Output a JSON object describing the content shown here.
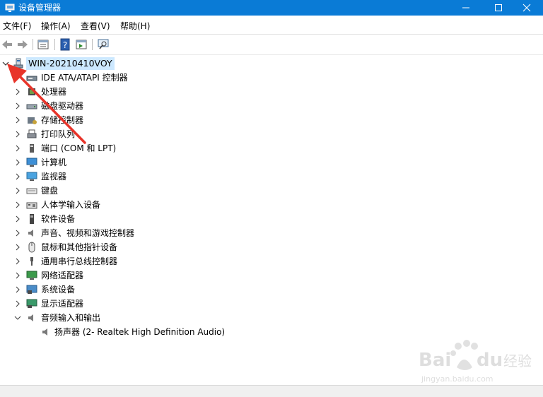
{
  "window": {
    "title": "设备管理器",
    "title_bar_color": "#0a7bd6"
  },
  "menu": {
    "items": [
      "文件(F)",
      "操作(A)",
      "查看(V)",
      "帮助(H)"
    ]
  },
  "toolbar": {
    "icons": [
      "back-arrow-icon",
      "forward-arrow-icon",
      "properties-icon",
      "help-icon",
      "action-pane-icon",
      "scan-hardware-icon"
    ]
  },
  "tree": {
    "root": {
      "label": "WIN-20210410VOY",
      "expanded": true
    },
    "categories": [
      {
        "label": "IDE ATA/ATAPI 控制器",
        "icon": "ide-controller-icon",
        "expanded": false
      },
      {
        "label": "处理器",
        "icon": "processor-icon",
        "expanded": false
      },
      {
        "label": "磁盘驱动器",
        "icon": "disk-drive-icon",
        "expanded": false
      },
      {
        "label": "存储控制器",
        "icon": "storage-controller-icon",
        "expanded": false
      },
      {
        "label": "打印队列",
        "icon": "printer-icon",
        "expanded": false
      },
      {
        "label": "端口 (COM 和 LPT)",
        "icon": "port-icon",
        "expanded": false
      },
      {
        "label": "计算机",
        "icon": "computer-icon",
        "expanded": false
      },
      {
        "label": "监视器",
        "icon": "monitor-icon",
        "expanded": false
      },
      {
        "label": "键盘",
        "icon": "keyboard-icon",
        "expanded": false
      },
      {
        "label": "人体学输入设备",
        "icon": "hid-icon",
        "expanded": false
      },
      {
        "label": "软件设备",
        "icon": "software-device-icon",
        "expanded": false
      },
      {
        "label": "声音、视频和游戏控制器",
        "icon": "sound-icon",
        "expanded": false
      },
      {
        "label": "鼠标和其他指针设备",
        "icon": "mouse-icon",
        "expanded": false
      },
      {
        "label": "通用串行总线控制器",
        "icon": "usb-icon",
        "expanded": false
      },
      {
        "label": "网络适配器",
        "icon": "network-adapter-icon",
        "expanded": false
      },
      {
        "label": "系统设备",
        "icon": "system-device-icon",
        "expanded": false
      },
      {
        "label": "显示适配器",
        "icon": "display-adapter-icon",
        "expanded": false
      },
      {
        "label": "音频输入和输出",
        "icon": "audio-io-icon",
        "expanded": true
      }
    ],
    "audio_children": [
      {
        "label": "扬声器 (2- Realtek High Definition Audio)",
        "icon": "speaker-icon"
      }
    ]
  },
  "annotation": {
    "arrow_color": "#e8342a"
  },
  "watermark": {
    "brand": "Baidu经验",
    "url": "jingyan.baidu.com"
  }
}
